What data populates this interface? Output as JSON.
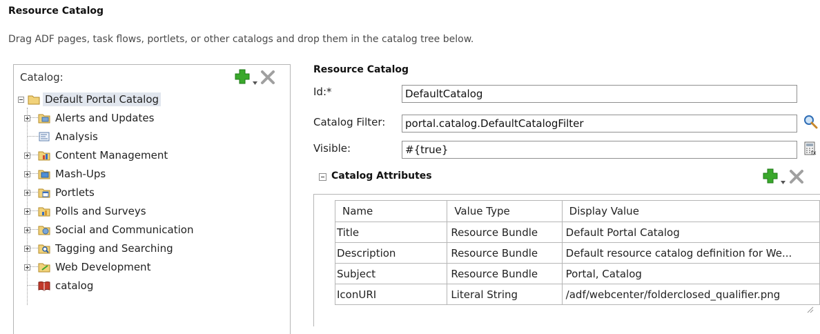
{
  "page": {
    "title": "Resource Catalog",
    "description": "Drag ADF pages, task flows, portlets, or other catalogs and drop them in the catalog tree below."
  },
  "catalog_panel": {
    "label": "Catalog:",
    "toolbar": {
      "add_icon": "green-plus-icon",
      "menu_icon": "dropdown-arrow-icon",
      "delete_icon": "gray-x-icon"
    },
    "root": {
      "label": "Default Portal Catalog",
      "expanded": true,
      "selected": true
    },
    "items": [
      {
        "label": "Alerts and Updates",
        "expandable": true,
        "icon": "alerts-folder-icon"
      },
      {
        "label": "Analysis",
        "expandable": false,
        "icon": "analysis-icon"
      },
      {
        "label": "Content Management",
        "expandable": true,
        "icon": "content-folder-icon"
      },
      {
        "label": "Mash-Ups",
        "expandable": true,
        "icon": "mashup-folder-icon"
      },
      {
        "label": "Portlets",
        "expandable": true,
        "icon": "portlets-folder-icon"
      },
      {
        "label": "Polls and Surveys",
        "expandable": true,
        "icon": "polls-folder-icon"
      },
      {
        "label": "Social and Communication",
        "expandable": true,
        "icon": "social-folder-icon"
      },
      {
        "label": "Tagging and Searching",
        "expandable": true,
        "icon": "search-folder-icon"
      },
      {
        "label": "Web Development",
        "expandable": true,
        "icon": "webdev-folder-icon"
      },
      {
        "label": "catalog",
        "expandable": false,
        "icon": "book-icon"
      }
    ]
  },
  "resource_catalog": {
    "title": "Resource Catalog",
    "id_label": "Id:*",
    "id_value": "DefaultCatalog",
    "filter_label": "Catalog Filter:",
    "filter_value": "portal.catalog.DefaultCatalogFilter",
    "visible_label": "Visible:",
    "visible_value": "#{true}"
  },
  "attributes": {
    "title": "Catalog Attributes",
    "columns": [
      "Name",
      "Value Type",
      "Display Value"
    ],
    "rows": [
      {
        "name": "Title",
        "type": "Resource Bundle",
        "value": "Default Portal Catalog"
      },
      {
        "name": "Description",
        "type": "Resource Bundle",
        "value": "Default resource catalog definition for We..."
      },
      {
        "name": "Subject",
        "type": "Resource Bundle",
        "value": "Portal, Catalog"
      },
      {
        "name": "IconURI",
        "type": "Literal String",
        "value": "/adf/webcenter/folderclosed_qualifier.png"
      }
    ]
  },
  "colors": {
    "add_green": "#3aa82c",
    "folder_yellow": "#f1d27a",
    "selection": "#e1e6ee",
    "border": "#b5b5b5"
  }
}
